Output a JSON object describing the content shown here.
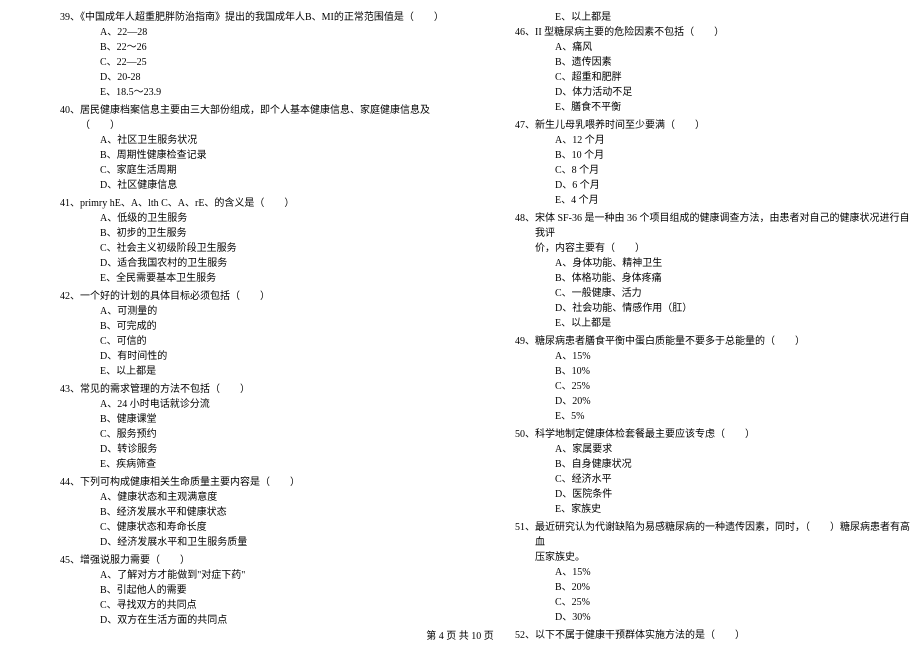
{
  "footer": "第 4 页 共 10 页",
  "blank_paren": "（　　）",
  "left": [
    {
      "number": "39、",
      "text": "《中国成年人超重肥胖防治指南》提出的我国成年人B、MI的正常范围值是（　　）",
      "options": [
        "A、22—28",
        "B、22～26",
        "C、22—25",
        "D、20-28",
        "E、18.5～23.9"
      ]
    },
    {
      "number": "40、",
      "text": "居民健康档案信息主要由三大部份组成，即个人基本健康信息、家庭健康信息及（　　）",
      "options": [
        "A、社区卫生服务状况",
        "B、周期性健康检查记录",
        "C、家庭生活周期",
        "D、社区健康信息"
      ]
    },
    {
      "number": "41、",
      "text": "primry hE、A、lth C、A、rE、的含义是（　　）",
      "options": [
        "A、低级的卫生服务",
        "B、初步的卫生服务",
        "C、社会主义初级阶段卫生服务",
        "D、适合我国农村的卫生服务",
        "E、全民需要基本卫生服务"
      ]
    },
    {
      "number": "42、",
      "text": "一个好的计划的具体目标必须包括（　　）",
      "options": [
        "A、可测量的",
        "B、可完成的",
        "C、可信的",
        "D、有时间性的",
        "E、以上都是"
      ]
    },
    {
      "number": "43、",
      "text": "常见的需求管理的方法不包括（　　）",
      "options": [
        "A、24 小时电话就诊分流",
        "B、健康课堂",
        "C、服务预约",
        "D、转诊服务",
        "E、疾病筛查"
      ]
    },
    {
      "number": "44、",
      "text": "下列可构成健康相关生命质量主要内容是（　　）",
      "options": [
        "A、健康状态和主观满意度",
        "B、经济发展水平和健康状态",
        "C、健康状态和寿命长度",
        "D、经济发展水平和卫生服务质量"
      ]
    },
    {
      "number": "45、",
      "text": "增强说服力需要（　　）",
      "options": [
        "A、了解对方才能做到\"对症下药\"",
        "B、引起他人的需要",
        "C、寻找双方的共同点",
        "D、双方在生活方面的共同点"
      ]
    }
  ],
  "right_first_options": [
    "E、以上都是"
  ],
  "right": [
    {
      "number": "46、",
      "text": "II 型糖尿病主要的危险因素不包括（　　）",
      "options": [
        "A、痛风",
        "B、遗传因素",
        "C、超重和肥胖",
        "D、体力活动不足",
        "E、膳食不平衡"
      ]
    },
    {
      "number": "47、",
      "text": "新生儿母乳喂养时间至少要满（　　）",
      "options": [
        "A、12 个月",
        "B、10 个月",
        "C、8 个月",
        "D、6 个月",
        "E、4 个月"
      ]
    },
    {
      "number": "48、",
      "text": "宋体 SF-36 是一种由 36 个项目组成的健康调查方法，由患者对自己的健康状况进行自我评价，内容主要有（　　）",
      "options": [
        "A、身体功能、精神卫生",
        "B、体格功能、身体疼痛",
        "C、一般健康、活力",
        "D、社会功能、情感作用（肛）",
        "E、以上都是"
      ]
    },
    {
      "number": "49、",
      "text": "糖尿病患者膳食平衡中蛋白质能量不要多于总能量的（　　）",
      "options": [
        "A、15%",
        "B、10%",
        "C、25%",
        "D、20%",
        "E、5%"
      ]
    },
    {
      "number": "50、",
      "text": "科学地制定健康体检套餐最主要应该专虑（　　）",
      "options": [
        "A、家属要求",
        "B、自身健康状况",
        "C、经济水平",
        "D、医院条件",
        "E、家族史"
      ]
    },
    {
      "number": "51、",
      "text": "最近研究认为代谢缺陷为易感糖尿病的一种遗传因素，同时，（　　）糖尿病患者有高血压家族史。",
      "options": [
        "A、15%",
        "B、20%",
        "C、25%",
        "D、30%"
      ]
    },
    {
      "number": "52、",
      "text": "以下不属于健康干预群体实施方法的是（　　）",
      "options": []
    }
  ]
}
